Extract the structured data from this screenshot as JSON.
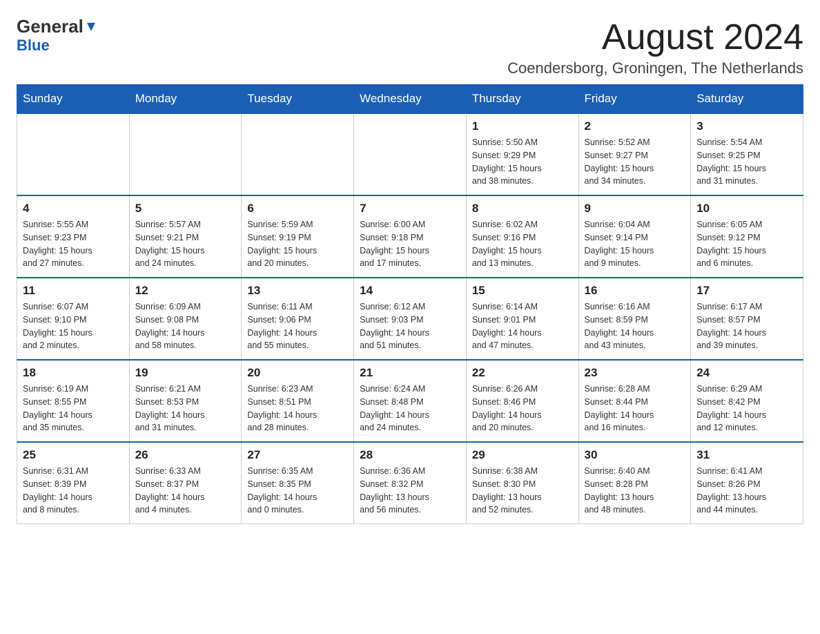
{
  "logo": {
    "part1": "General",
    "part2": "Blue"
  },
  "header": {
    "month_year": "August 2024",
    "location": "Coendersborg, Groningen, The Netherlands"
  },
  "days_of_week": [
    "Sunday",
    "Monday",
    "Tuesday",
    "Wednesday",
    "Thursday",
    "Friday",
    "Saturday"
  ],
  "weeks": [
    [
      {
        "day": "",
        "info": ""
      },
      {
        "day": "",
        "info": ""
      },
      {
        "day": "",
        "info": ""
      },
      {
        "day": "",
        "info": ""
      },
      {
        "day": "1",
        "info": "Sunrise: 5:50 AM\nSunset: 9:29 PM\nDaylight: 15 hours\nand 38 minutes."
      },
      {
        "day": "2",
        "info": "Sunrise: 5:52 AM\nSunset: 9:27 PM\nDaylight: 15 hours\nand 34 minutes."
      },
      {
        "day": "3",
        "info": "Sunrise: 5:54 AM\nSunset: 9:25 PM\nDaylight: 15 hours\nand 31 minutes."
      }
    ],
    [
      {
        "day": "4",
        "info": "Sunrise: 5:55 AM\nSunset: 9:23 PM\nDaylight: 15 hours\nand 27 minutes."
      },
      {
        "day": "5",
        "info": "Sunrise: 5:57 AM\nSunset: 9:21 PM\nDaylight: 15 hours\nand 24 minutes."
      },
      {
        "day": "6",
        "info": "Sunrise: 5:59 AM\nSunset: 9:19 PM\nDaylight: 15 hours\nand 20 minutes."
      },
      {
        "day": "7",
        "info": "Sunrise: 6:00 AM\nSunset: 9:18 PM\nDaylight: 15 hours\nand 17 minutes."
      },
      {
        "day": "8",
        "info": "Sunrise: 6:02 AM\nSunset: 9:16 PM\nDaylight: 15 hours\nand 13 minutes."
      },
      {
        "day": "9",
        "info": "Sunrise: 6:04 AM\nSunset: 9:14 PM\nDaylight: 15 hours\nand 9 minutes."
      },
      {
        "day": "10",
        "info": "Sunrise: 6:05 AM\nSunset: 9:12 PM\nDaylight: 15 hours\nand 6 minutes."
      }
    ],
    [
      {
        "day": "11",
        "info": "Sunrise: 6:07 AM\nSunset: 9:10 PM\nDaylight: 15 hours\nand 2 minutes."
      },
      {
        "day": "12",
        "info": "Sunrise: 6:09 AM\nSunset: 9:08 PM\nDaylight: 14 hours\nand 58 minutes."
      },
      {
        "day": "13",
        "info": "Sunrise: 6:11 AM\nSunset: 9:06 PM\nDaylight: 14 hours\nand 55 minutes."
      },
      {
        "day": "14",
        "info": "Sunrise: 6:12 AM\nSunset: 9:03 PM\nDaylight: 14 hours\nand 51 minutes."
      },
      {
        "day": "15",
        "info": "Sunrise: 6:14 AM\nSunset: 9:01 PM\nDaylight: 14 hours\nand 47 minutes."
      },
      {
        "day": "16",
        "info": "Sunrise: 6:16 AM\nSunset: 8:59 PM\nDaylight: 14 hours\nand 43 minutes."
      },
      {
        "day": "17",
        "info": "Sunrise: 6:17 AM\nSunset: 8:57 PM\nDaylight: 14 hours\nand 39 minutes."
      }
    ],
    [
      {
        "day": "18",
        "info": "Sunrise: 6:19 AM\nSunset: 8:55 PM\nDaylight: 14 hours\nand 35 minutes."
      },
      {
        "day": "19",
        "info": "Sunrise: 6:21 AM\nSunset: 8:53 PM\nDaylight: 14 hours\nand 31 minutes."
      },
      {
        "day": "20",
        "info": "Sunrise: 6:23 AM\nSunset: 8:51 PM\nDaylight: 14 hours\nand 28 minutes."
      },
      {
        "day": "21",
        "info": "Sunrise: 6:24 AM\nSunset: 8:48 PM\nDaylight: 14 hours\nand 24 minutes."
      },
      {
        "day": "22",
        "info": "Sunrise: 6:26 AM\nSunset: 8:46 PM\nDaylight: 14 hours\nand 20 minutes."
      },
      {
        "day": "23",
        "info": "Sunrise: 6:28 AM\nSunset: 8:44 PM\nDaylight: 14 hours\nand 16 minutes."
      },
      {
        "day": "24",
        "info": "Sunrise: 6:29 AM\nSunset: 8:42 PM\nDaylight: 14 hours\nand 12 minutes."
      }
    ],
    [
      {
        "day": "25",
        "info": "Sunrise: 6:31 AM\nSunset: 8:39 PM\nDaylight: 14 hours\nand 8 minutes."
      },
      {
        "day": "26",
        "info": "Sunrise: 6:33 AM\nSunset: 8:37 PM\nDaylight: 14 hours\nand 4 minutes."
      },
      {
        "day": "27",
        "info": "Sunrise: 6:35 AM\nSunset: 8:35 PM\nDaylight: 14 hours\nand 0 minutes."
      },
      {
        "day": "28",
        "info": "Sunrise: 6:36 AM\nSunset: 8:32 PM\nDaylight: 13 hours\nand 56 minutes."
      },
      {
        "day": "29",
        "info": "Sunrise: 6:38 AM\nSunset: 8:30 PM\nDaylight: 13 hours\nand 52 minutes."
      },
      {
        "day": "30",
        "info": "Sunrise: 6:40 AM\nSunset: 8:28 PM\nDaylight: 13 hours\nand 48 minutes."
      },
      {
        "day": "31",
        "info": "Sunrise: 6:41 AM\nSunset: 8:26 PM\nDaylight: 13 hours\nand 44 minutes."
      }
    ]
  ]
}
